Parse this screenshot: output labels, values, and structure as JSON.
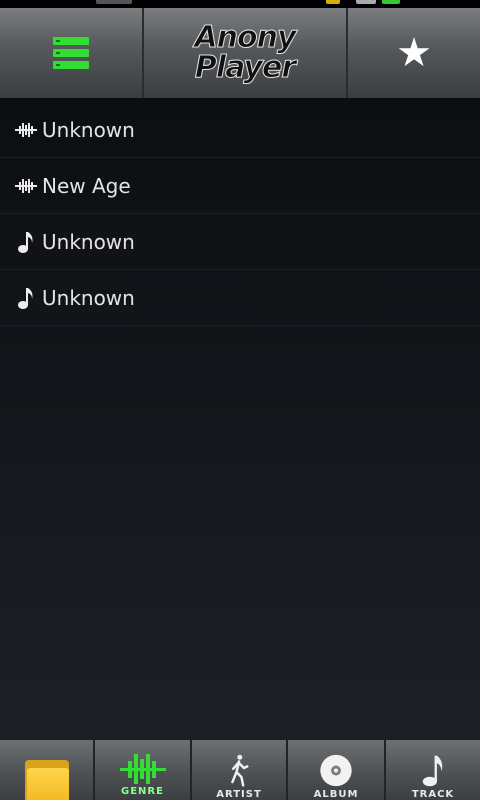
{
  "app": {
    "logo_line1": "Anony",
    "logo_line2": "Player"
  },
  "colors": {
    "accent_green": "#33dd33",
    "folder_yellow": "#f2b41e"
  },
  "toolbar": {
    "menu_icon": "menu-list-icon",
    "favorite_icon": "star-icon"
  },
  "list": {
    "items": [
      {
        "icon": "genre-waveform-icon",
        "label": "Unknown"
      },
      {
        "icon": "genre-waveform-icon",
        "label": "New Age"
      },
      {
        "icon": "music-note-icon",
        "label": "Unknown"
      },
      {
        "icon": "music-note-icon",
        "label": "Unknown"
      }
    ]
  },
  "tabs": [
    {
      "icon": "folder-icon",
      "label": ""
    },
    {
      "icon": "genre-waveform-icon",
      "label": "GENRE",
      "active": true
    },
    {
      "icon": "walking-person-icon",
      "label": "ARTIST"
    },
    {
      "icon": "disc-icon",
      "label": "ALBUM"
    },
    {
      "icon": "music-note-icon",
      "label": "TRACK"
    }
  ]
}
